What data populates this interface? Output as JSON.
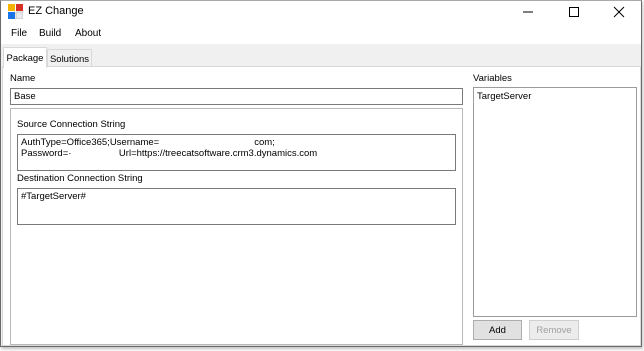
{
  "window": {
    "title": "EZ Change",
    "icon": "app-icon",
    "controls": {
      "minimize": "minimize-icon",
      "maximize": "maximize-icon",
      "close": "close-icon"
    }
  },
  "menu": {
    "items": [
      "File",
      "Build",
      "About"
    ]
  },
  "tabs": [
    {
      "label": "Package",
      "selected": true
    },
    {
      "label": "Solutions",
      "selected": false
    }
  ],
  "package": {
    "name_label": "Name",
    "name_value": "Base",
    "source_label": "Source Connection String",
    "source_value": "AuthType=Office365;Username=                                    com;\nPassword=·                  Url=https://treecatsoftware.crm3.dynamics.com",
    "destination_label": "Destination Connection String",
    "destination_value": "#TargetServer#"
  },
  "variables": {
    "label": "Variables",
    "items": [
      "TargetServer"
    ],
    "add_label": "Add",
    "remove_label": "Remove",
    "remove_enabled": false
  }
}
